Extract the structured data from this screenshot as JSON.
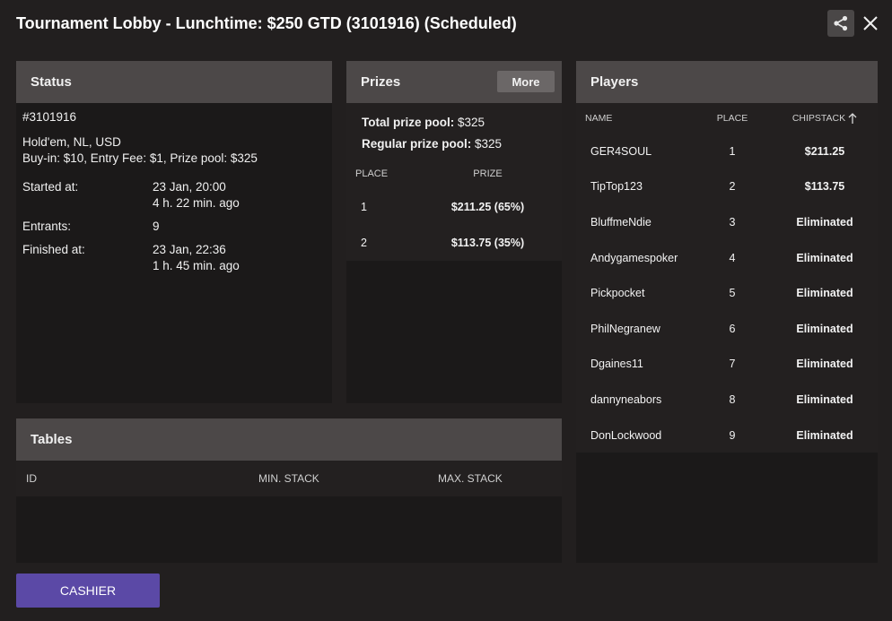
{
  "title": "Tournament Lobby - Lunchtime: $250 GTD (3101916) (Scheduled)",
  "icons": {
    "share": "share-icon",
    "close": "close-icon",
    "sort": "arrow-up-icon"
  },
  "colors": {
    "accent": "#5b49a6",
    "panel_header": "#4c4848",
    "background": "#221f1f"
  },
  "status": {
    "heading": "Status",
    "id": "#3101916",
    "game": "Hold'em, NL, USD",
    "buyin": "Buy-in: $10, Entry Fee: $1, Prize pool: $325",
    "started_label": "Started at:",
    "started_date": "23 Jan, 20:00",
    "started_ago": "4 h. 22 min. ago",
    "entrants_label": "Entrants:",
    "entrants_value": "9",
    "finished_label": "Finished at:",
    "finished_date": "23 Jan, 22:36",
    "finished_ago": "1 h. 45 min. ago"
  },
  "prizes": {
    "heading": "Prizes",
    "more_label": "More",
    "total_label": "Total prize pool:",
    "total_value": "$325",
    "regular_label": "Regular prize pool:",
    "regular_value": "$325",
    "col_place": "PLACE",
    "col_prize": "PRIZE",
    "rows": [
      {
        "place": "1",
        "prize": "$211.25 (65%)"
      },
      {
        "place": "2",
        "prize": "$113.75 (35%)"
      }
    ]
  },
  "players": {
    "heading": "Players",
    "col_name": "NAME",
    "col_place": "PLACE",
    "col_chips": "CHIPSTACK",
    "rows": [
      {
        "name": "GER4SOUL",
        "place": "1",
        "chips": "$211.25"
      },
      {
        "name": "TipTop123",
        "place": "2",
        "chips": "$113.75"
      },
      {
        "name": "BluffmeNdie",
        "place": "3",
        "chips": "Eliminated"
      },
      {
        "name": "Andygamespoker",
        "place": "4",
        "chips": "Eliminated"
      },
      {
        "name": "Pickpocket",
        "place": "5",
        "chips": "Eliminated"
      },
      {
        "name": "PhilNegranew",
        "place": "6",
        "chips": "Eliminated"
      },
      {
        "name": "Dgaines11",
        "place": "7",
        "chips": "Eliminated"
      },
      {
        "name": "dannyneabors",
        "place": "8",
        "chips": "Eliminated"
      },
      {
        "name": "DonLockwood",
        "place": "9",
        "chips": "Eliminated"
      }
    ]
  },
  "tables": {
    "heading": "Tables",
    "col_id": "ID",
    "col_min": "MIN. STACK",
    "col_max": "MAX. STACK"
  },
  "cashier_label": "CASHIER"
}
